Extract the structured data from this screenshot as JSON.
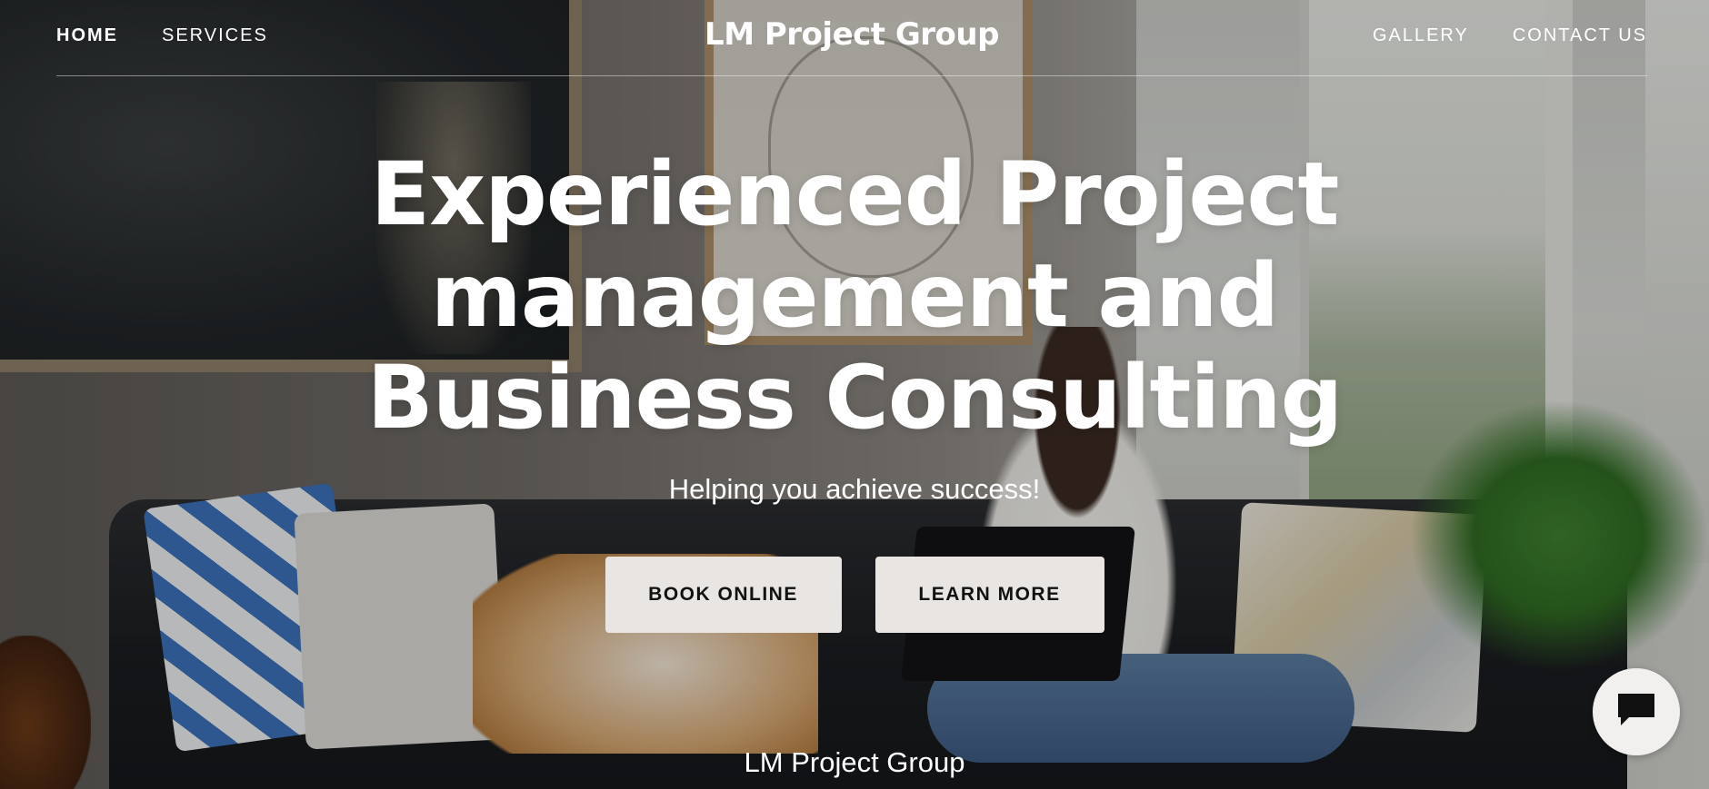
{
  "header": {
    "brand": "LM Project Group",
    "nav_left": [
      {
        "label": "HOME",
        "active": true
      },
      {
        "label": "SERVICES",
        "active": false
      }
    ],
    "nav_right": [
      {
        "label": "GALLERY",
        "active": false
      },
      {
        "label": "CONTACT US",
        "active": false
      }
    ]
  },
  "hero": {
    "title_line1": "Experienced Project",
    "title_line2": "management and",
    "title_line3": "Business Consulting",
    "subtitle": "Helping you achieve success!",
    "primary_button": "BOOK ONLINE",
    "secondary_button": "LEARN MORE"
  },
  "footer": {
    "brand": "LM Project Group"
  },
  "chat_widget": {
    "icon": "chat-bubble-icon",
    "background": "#f2f0ee",
    "icon_color": "#111111"
  },
  "colors": {
    "button_bg": "#e9e5e2",
    "text_light": "#ffffff"
  }
}
